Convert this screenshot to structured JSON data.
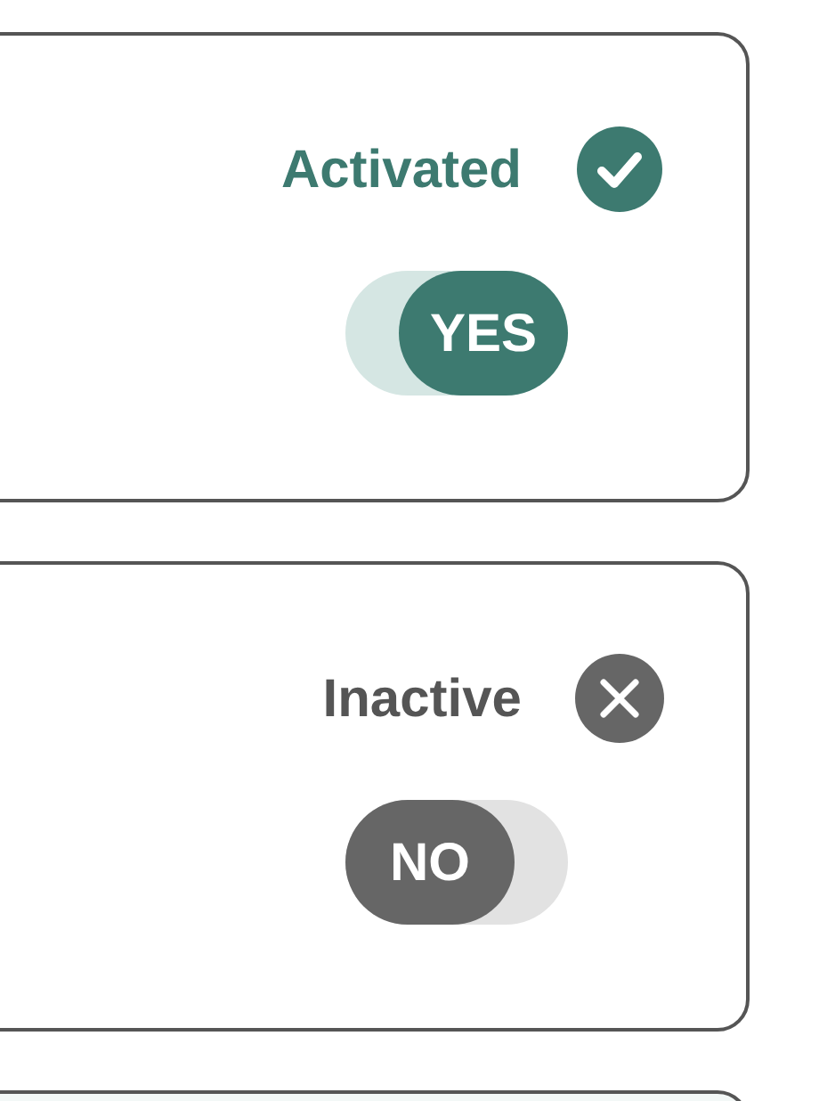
{
  "cards": [
    {
      "status": "Activated",
      "active": true,
      "toggle_label": "YES"
    },
    {
      "status": "Inactive",
      "active": false,
      "toggle_label": "NO"
    }
  ]
}
